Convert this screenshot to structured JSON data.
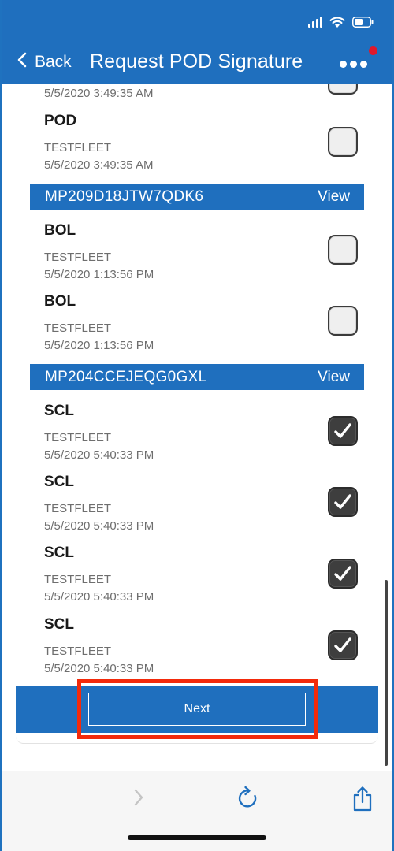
{
  "header": {
    "back_label": "Back",
    "title": "Request POD Signature"
  },
  "colors": {
    "primary": "#1f6fbe",
    "highlight": "#f32a0b",
    "notification": "#e0182b"
  },
  "list": {
    "partial_item": {
      "date": "5/5/2020 3:49:35 AM"
    },
    "item_pod": {
      "title": "POD",
      "fleet": "TESTFLEET",
      "date": "5/5/2020 3:49:35 AM",
      "checked": false
    },
    "group1": {
      "id": "MP209D18JTW7QDK6",
      "view_label": "View",
      "items": [
        {
          "title": "BOL",
          "fleet": "TESTFLEET",
          "date": "5/5/2020 1:13:56 PM",
          "checked": false
        },
        {
          "title": "BOL",
          "fleet": "TESTFLEET",
          "date": "5/5/2020 1:13:56 PM",
          "checked": false
        }
      ]
    },
    "group2": {
      "id": "MP204CCEJEQG0GXL",
      "view_label": "View",
      "items": [
        {
          "title": "SCL",
          "fleet": "TESTFLEET",
          "date": "5/5/2020 5:40:33 PM",
          "checked": true
        },
        {
          "title": "SCL",
          "fleet": "TESTFLEET",
          "date": "5/5/2020 5:40:33 PM",
          "checked": true
        },
        {
          "title": "SCL",
          "fleet": "TESTFLEET",
          "date": "5/5/2020 5:40:33 PM",
          "checked": true
        },
        {
          "title": "SCL",
          "fleet": "TESTFLEET",
          "date": "5/5/2020 5:40:33 PM",
          "checked": true
        }
      ]
    }
  },
  "footer": {
    "next_label": "Next"
  },
  "icons": {
    "back": "chevron-left-icon",
    "more": "more-dots-icon",
    "forward": "chevron-right-icon",
    "refresh": "refresh-icon",
    "share": "share-icon"
  }
}
